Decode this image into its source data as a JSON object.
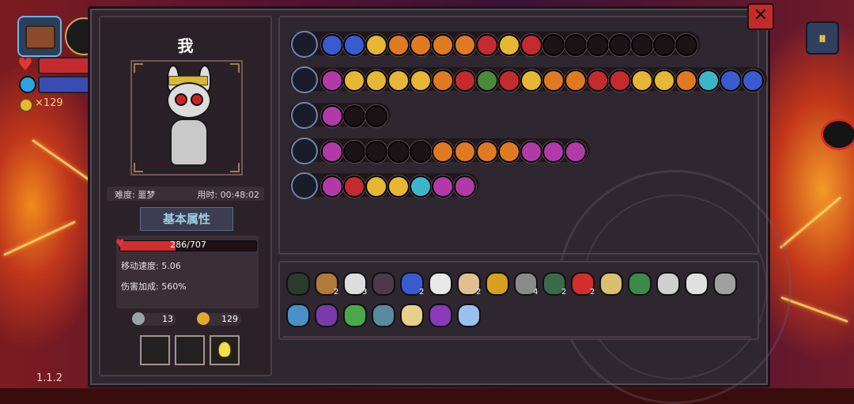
{
  "hud": {
    "gold": "×129",
    "version": "1.1.2",
    "pause_icon": "⏸"
  },
  "panel": {
    "close_label": "✕"
  },
  "player": {
    "name": "我",
    "difficulty_label": "难度: 噩梦",
    "time_label": "用时: 00:48:02",
    "attr_title": "基本属性",
    "hp_text": "286/707",
    "hp_fraction": 0.405,
    "move_speed": "移动速度: 5.06",
    "damage_bonus": "伤害加成: 560%",
    "keys": "13",
    "coins": "129"
  },
  "colors": {
    "gold": "#e6b634",
    "purple": "#b23aa8",
    "red": "#c52a2e",
    "blue": "#3a5ad0",
    "cyan": "#3ab6c8",
    "orange": "#e07a22",
    "green": "#4a8a3a",
    "dark": "#1b1417"
  },
  "loadout_rows": [
    {
      "main_icon": "treasure-chest-icon",
      "slots": [
        "blue",
        "blue",
        "gold",
        "orange",
        "orange",
        "orange",
        "orange",
        "red",
        "gold",
        "red",
        "dark",
        "dark",
        "dark",
        "dark",
        "dark",
        "dark",
        "dark"
      ]
    },
    {
      "main_icon": "staff-weapon-icon",
      "slots": [
        "purple",
        "gold",
        "gold",
        "gold",
        "gold",
        "orange",
        "red",
        "green",
        "red",
        "gold",
        "orange",
        "orange",
        "red",
        "red",
        "gold",
        "gold",
        "orange",
        "cyan",
        "blue",
        "blue"
      ]
    },
    {
      "main_icon": "purple-orb-icon",
      "slots": [
        "purple",
        "dark",
        "dark"
      ]
    },
    {
      "main_icon": "scepter-weapon-icon",
      "slots": [
        "purple",
        "dark",
        "dark",
        "dark",
        "dark",
        "orange",
        "orange",
        "orange",
        "orange",
        "purple",
        "purple",
        "purple"
      ]
    },
    {
      "main_icon": "gold-rune-icon",
      "slots": [
        "purple",
        "red",
        "gold",
        "gold",
        "cyan",
        "purple",
        "purple"
      ]
    }
  ],
  "inventory": [
    {
      "icon": "hooded-mask-icon",
      "count": ""
    },
    {
      "icon": "pickaxe-icon",
      "count": "2"
    },
    {
      "icon": "fang-icon",
      "count": "3"
    },
    {
      "icon": "horned-helm-icon",
      "count": ""
    },
    {
      "icon": "blue-glove-icon",
      "count": "2"
    },
    {
      "icon": "wing-icon",
      "count": ""
    },
    {
      "icon": "feather-icon",
      "count": "2"
    },
    {
      "icon": "gauntlet-icon",
      "count": ""
    },
    {
      "icon": "sword-icon",
      "count": "4"
    },
    {
      "icon": "green-belt-icon",
      "count": "2"
    },
    {
      "icon": "red-eye-icon",
      "count": "2"
    },
    {
      "icon": "antler-icon",
      "count": ""
    },
    {
      "icon": "green-boot-icon",
      "count": ""
    },
    {
      "icon": "white-gem-icon",
      "count": ""
    },
    {
      "icon": "quill-icon",
      "count": ""
    },
    {
      "icon": "dagger-icon",
      "count": ""
    },
    {
      "icon": "magnifier-icon",
      "count": ""
    },
    {
      "icon": "rune-book-icon",
      "count": ""
    },
    {
      "icon": "leaf-wand-icon",
      "count": ""
    },
    {
      "icon": "crystal-ball-icon",
      "count": ""
    },
    {
      "icon": "bread-icon",
      "count": ""
    },
    {
      "icon": "purple-boot-icon",
      "count": ""
    },
    {
      "icon": "blue-egg-icon",
      "count": ""
    }
  ]
}
